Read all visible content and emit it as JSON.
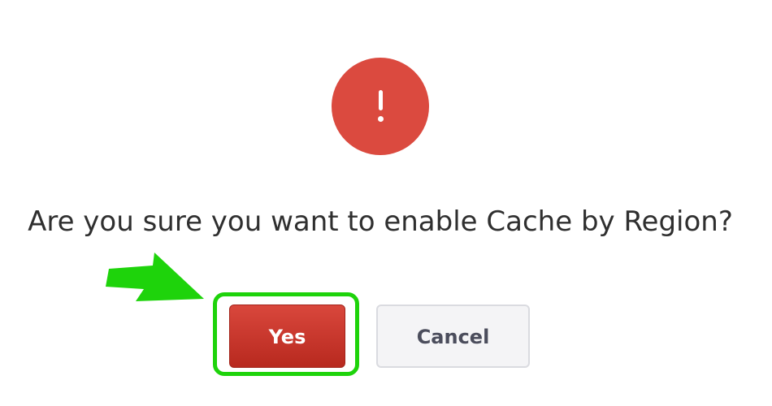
{
  "dialog": {
    "icon": "exclamation-icon",
    "icon_color": "#db4a3f",
    "message": "Are you sure you want to enable Cache by Region?",
    "confirm_label": "Yes",
    "cancel_label": "Cancel",
    "confirm_color": "#c7362b"
  },
  "annotation": {
    "highlight_color": "#1ed30b",
    "pointer": "arrow-pointer-icon"
  }
}
